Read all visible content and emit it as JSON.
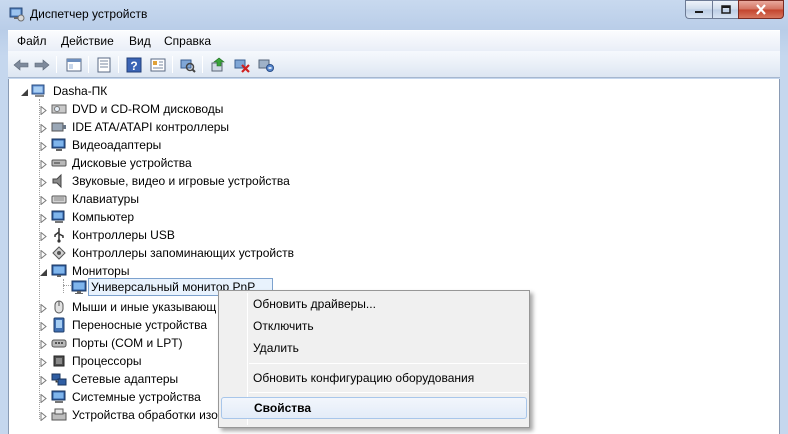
{
  "window": {
    "title": "Диспетчер устройств",
    "icon": "device-manager-icon"
  },
  "caption": {
    "minimize": "–",
    "maximize": "□",
    "close": "✕"
  },
  "menu": {
    "items": [
      {
        "label": "Файл"
      },
      {
        "label": "Действие"
      },
      {
        "label": "Вид"
      },
      {
        "label": "Справка"
      }
    ]
  },
  "toolbar": {
    "buttons": [
      "back-arrow-icon",
      "forward-arrow-icon",
      "console-tree-icon",
      "properties-icon",
      "help-icon",
      "view-icon",
      "scan-hardware-icon",
      "update-driver-icon",
      "disable-device-icon",
      "uninstall-device-icon"
    ]
  },
  "tree": {
    "root": "Dasha-ПК",
    "categories": [
      {
        "label": "DVD и CD-ROM дисководы",
        "icon": "dvd-drive-icon"
      },
      {
        "label": "IDE ATA/ATAPI контроллеры",
        "icon": "ide-controller-icon"
      },
      {
        "label": "Видеоадаптеры",
        "icon": "display-adapter-icon"
      },
      {
        "label": "Дисковые устройства",
        "icon": "disk-drive-icon"
      },
      {
        "label": "Звуковые, видео и игровые устройства",
        "icon": "speaker-icon"
      },
      {
        "label": "Клавиатуры",
        "icon": "keyboard-icon"
      },
      {
        "label": "Компьютер",
        "icon": "computer-icon"
      },
      {
        "label": "Контроллеры USB",
        "icon": "usb-icon"
      },
      {
        "label": "Контроллеры запоминающих устройств",
        "icon": "storage-controller-icon"
      },
      {
        "label": "Мониторы",
        "icon": "monitor-icon"
      },
      {
        "label": "Мыши и иные указывающ",
        "icon": "mouse-icon"
      },
      {
        "label": "Переносные устройства",
        "icon": "portable-device-icon"
      },
      {
        "label": "Порты (COM и LPT)",
        "icon": "port-icon"
      },
      {
        "label": "Процессоры",
        "icon": "processor-icon"
      },
      {
        "label": "Сетевые адаптеры",
        "icon": "network-adapter-icon"
      },
      {
        "label": "Системные устройства",
        "icon": "system-device-icon"
      },
      {
        "label": "Устройства обработки изо",
        "icon": "imaging-device-icon"
      }
    ],
    "selected_child": "Универсальный монитор PnP"
  },
  "context_menu": {
    "items": [
      {
        "label": "Обновить драйверы..."
      },
      {
        "label": "Отключить"
      },
      {
        "label": "Удалить"
      },
      {
        "label": "Обновить конфигурацию оборудования"
      },
      {
        "label": "Свойства"
      }
    ]
  },
  "colors": {
    "frame": "#b9cde8",
    "selection": "#e8f2fd",
    "selection_border": "#7da2ce",
    "close_button": "#c3432c"
  }
}
